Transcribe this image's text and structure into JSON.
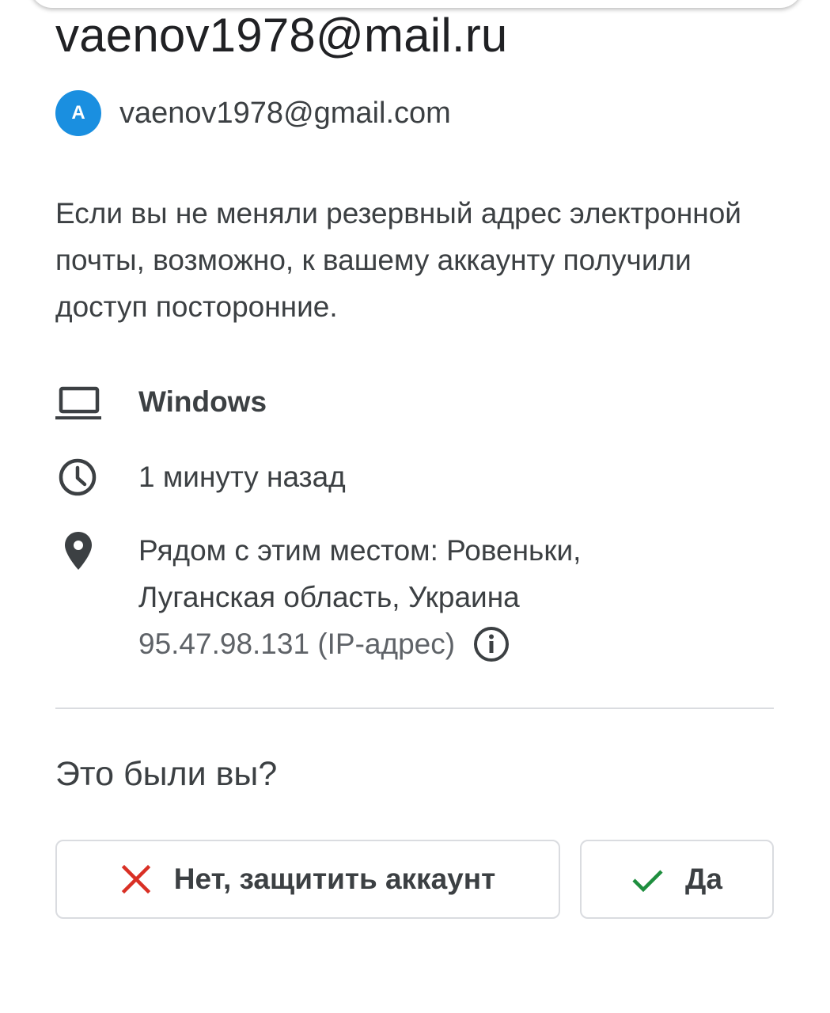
{
  "header": {
    "title": "vaenov1978@mail.ru"
  },
  "account": {
    "avatar_letter": "A",
    "avatar_color": "#1a8fe0",
    "email": "vaenov1978@gmail.com"
  },
  "message": "Если вы не меняли резервный адрес электронной почты, возможно, к вашему аккаунту получили доступ посторонние.",
  "details": {
    "device": {
      "icon": "laptop-icon",
      "label": "Windows"
    },
    "time": {
      "icon": "clock-icon",
      "label": "1 минуту назад"
    },
    "location": {
      "icon": "location-pin-icon",
      "line1": "Рядом с этим местом: Ровеньки,",
      "line2": "Луганская область, Украина",
      "ip": "95.47.98.131 (IP-адрес)",
      "info_icon": "info-icon"
    }
  },
  "question": "Это были вы?",
  "buttons": {
    "no": {
      "icon": "close-icon",
      "icon_color": "#d93025",
      "label": "Нет, защитить аккаунт"
    },
    "yes": {
      "icon": "check-icon",
      "icon_color": "#1e8e3e",
      "label": "Да"
    }
  }
}
